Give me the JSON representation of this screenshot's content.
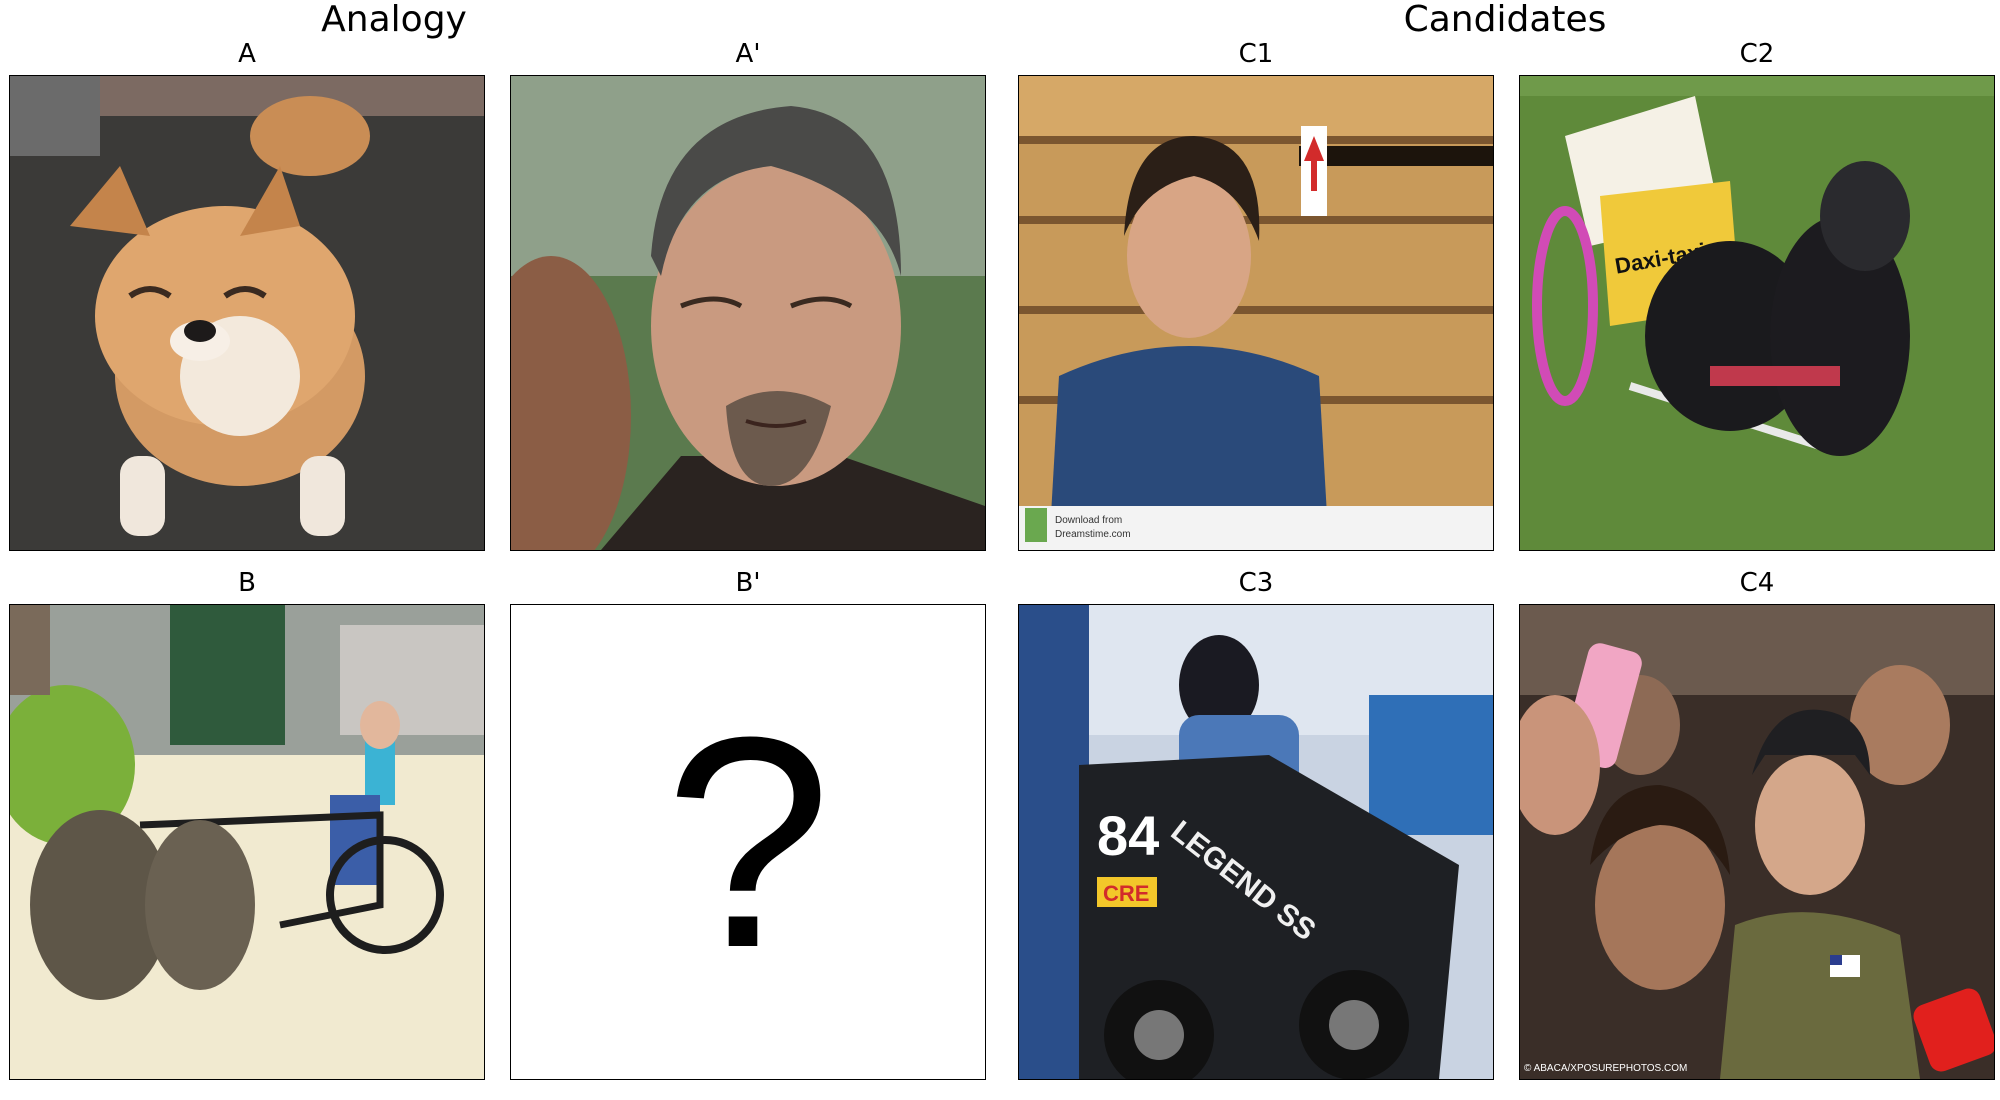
{
  "headings": {
    "analogy": "Analogy",
    "candidates": "Candidates"
  },
  "panels": {
    "A": {
      "label": "A",
      "subject": "shiba inu dog squinting"
    },
    "A_prime": {
      "label": "A'",
      "subject": "man squinting"
    },
    "B": {
      "label": "B",
      "subject": "dogs pulling a cart with a person"
    },
    "B_prime": {
      "label": "B'",
      "placeholder": "?"
    },
    "C1": {
      "label": "C1",
      "subject": "man squinting in front of wooden crates",
      "watermark_lines": [
        "Download from",
        "Dreamstime.com"
      ]
    },
    "C2": {
      "label": "C2",
      "subject": "dog pulling a small cart",
      "cart_sign": "Daxi-taxi"
    },
    "C3": {
      "label": "C3",
      "subject": "driver in a go-kart",
      "kart_number": "84",
      "kart_text": "LEGEND SS",
      "kart_sticker": "CRE"
    },
    "C4": {
      "label": "C4",
      "subject": "crowd around a young man",
      "credit": "© ABACA/XPOSUREPHOTOS.COM"
    }
  },
  "colors": {
    "background": "#ffffff",
    "frame_border": "#000000"
  }
}
